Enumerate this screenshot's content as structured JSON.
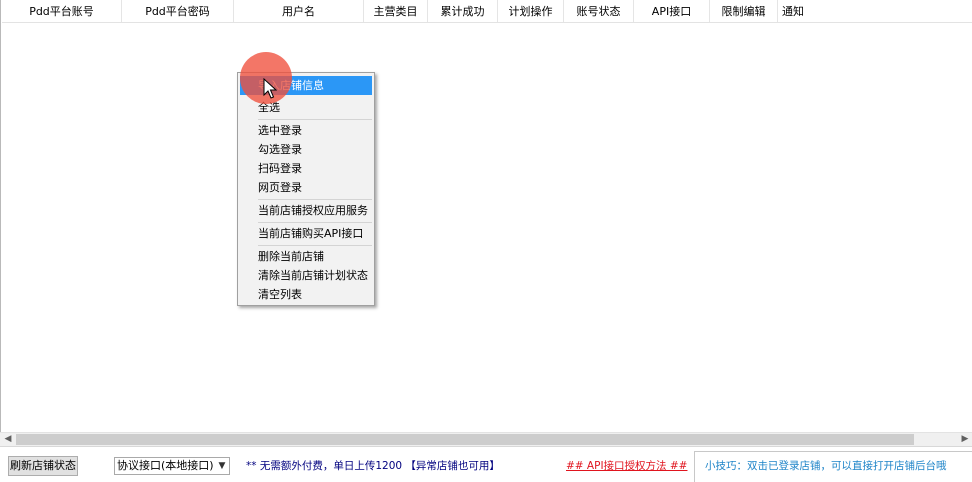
{
  "table": {
    "columns": [
      "Pdd平台账号",
      "Pdd平台密码",
      "用户名",
      "主营类目",
      "累计成功",
      "计划操作",
      "账号状态",
      "API接口",
      "限制编辑",
      "通知"
    ]
  },
  "context_menu": {
    "items": [
      {
        "label": "导入店铺信息"
      },
      {
        "label": "全选"
      },
      {
        "label": "选中登录"
      },
      {
        "label": "勾选登录"
      },
      {
        "label": "扫码登录"
      },
      {
        "label": "网页登录"
      },
      {
        "label": "当前店铺授权应用服务"
      },
      {
        "label": "当前店铺购买API接口"
      },
      {
        "label": "删除当前店铺"
      },
      {
        "label": "清除当前店铺计划状态"
      },
      {
        "label": "清空列表"
      }
    ]
  },
  "bottom_bar": {
    "refresh_button": "刷新店铺状态",
    "protocol_select": "协议接口(本地接口)",
    "info_text": "** 无需额外付费，单日上传1200 【异常店铺也可用】",
    "api_link": "## API接口授权方法 ##",
    "tip_text": "小技巧：双击已登录店铺，可以直接打开店铺后台哦"
  },
  "icons": {
    "scroll_left": "chevron-left-icon",
    "scroll_right": "chevron-right-icon",
    "dropdown": "chevron-down-icon",
    "cursor": "mouse-pointer-icon"
  },
  "colors": {
    "menu_highlight": "#2b97f6",
    "info_text": "#00007f",
    "link": "#e0141e",
    "tip": "#1e84c8",
    "click_indicator": "#ef4f3c"
  }
}
